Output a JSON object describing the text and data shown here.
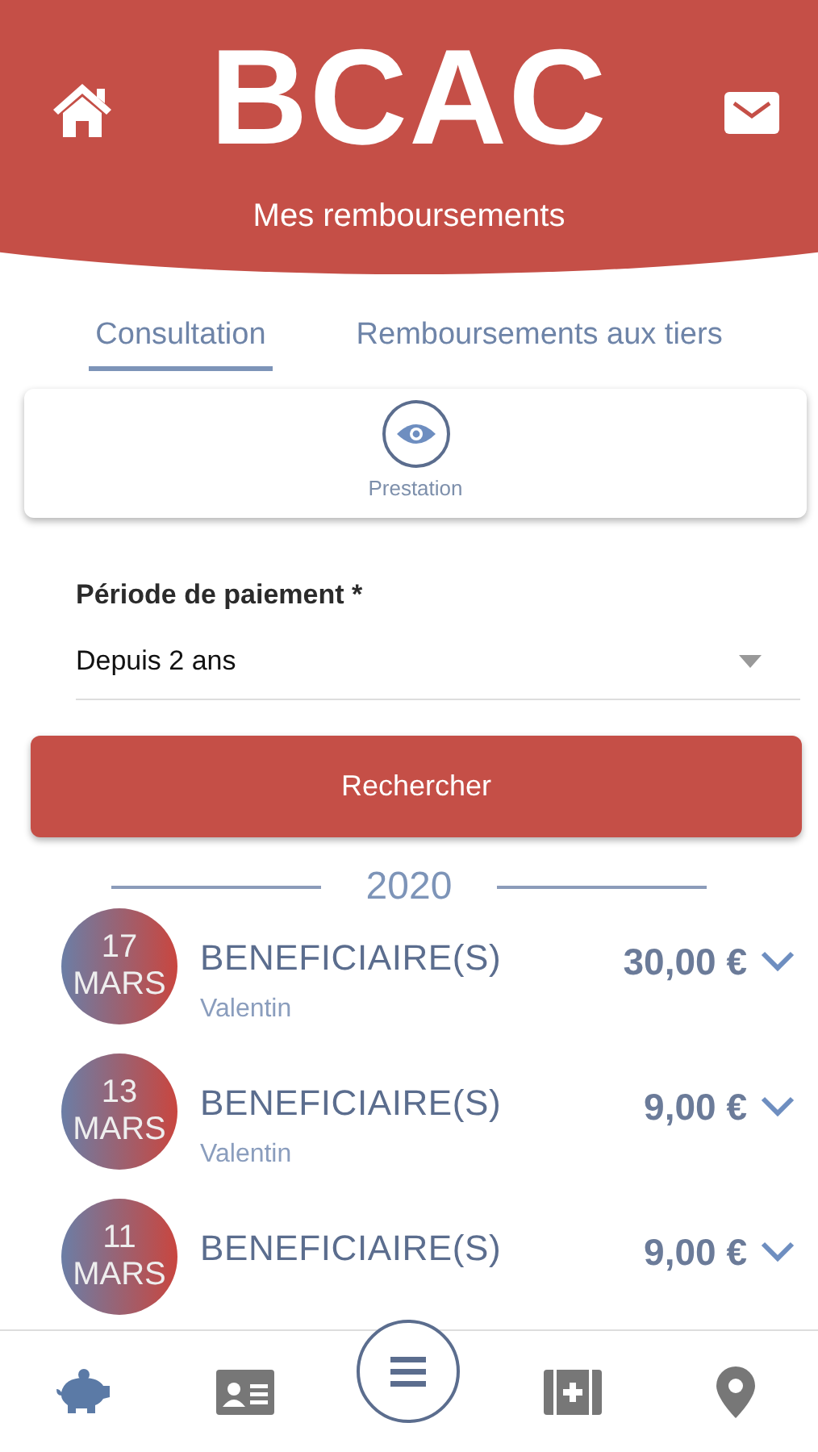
{
  "header": {
    "logo": "BCAC",
    "subtitle": "Mes remboursements"
  },
  "tabs": [
    {
      "label": "Consultation",
      "selected": true
    },
    {
      "label": "Remboursements aux tiers",
      "selected": false
    }
  ],
  "filter_card": {
    "label": "Prestation"
  },
  "period": {
    "label": "Période de paiement *",
    "value": "Depuis 2 ans"
  },
  "search_button": "Rechercher",
  "year": "2020",
  "payments": [
    {
      "day": "17",
      "month": "MARS",
      "title": "BENEFICIAIRE(S)",
      "name": "Valentin",
      "amount": "30,00 €"
    },
    {
      "day": "13",
      "month": "MARS",
      "title": "BENEFICIAIRE(S)",
      "name": "Valentin",
      "amount": "9,00 €"
    },
    {
      "day": "11",
      "month": "MARS",
      "title": "BENEFICIAIRE(S)",
      "amount": "9,00 €"
    }
  ],
  "bottom_nav": [
    {
      "kind": "piggy",
      "selected": true
    },
    {
      "kind": "card",
      "selected": false
    },
    {
      "kind": "menu",
      "selected": false
    },
    {
      "kind": "medical",
      "selected": false
    },
    {
      "kind": "pin",
      "selected": false
    }
  ]
}
